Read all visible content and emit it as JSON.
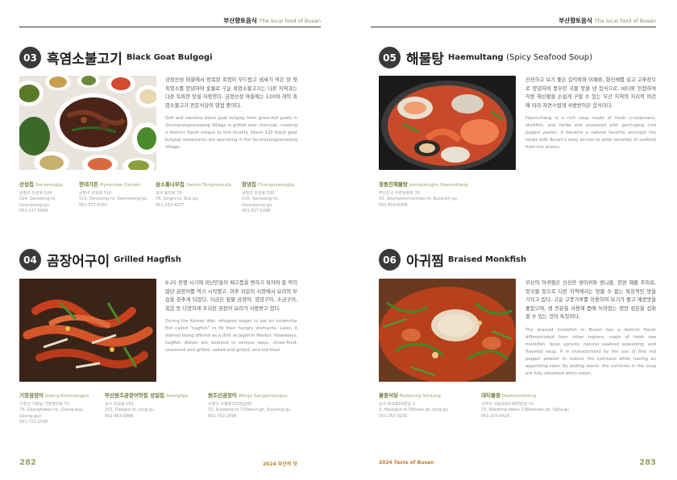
{
  "header": {
    "ko": "부산향토음식",
    "en": "The local food of Busan"
  },
  "left_page": {
    "page_number": "282",
    "footer": "2024 부산의 맛",
    "sections": [
      {
        "num": "03",
        "title_ko": "흑염소불고기",
        "title_en": "Black Goat Bulgogi",
        "title_en_light": "",
        "desc_ko": "금정산성 마을에서 방목된 흑염이 부드럽고 냄새가 적은 양 첫 흑염소를 양념하여 숯불로 구운 흑염소불고기는 다른 지역과는 다른 독특한 맛을 자랑한다. 금정산성 마을에는 120여 개의 흑염소불고기 전문식당이 영업 중이다.",
        "desc_en": "Soft and odorless black goat bulgogi from grass-fed goats in Geumjeongsanseong Village is grilled over charcoal, creating a distinct flavor unique to this locality. About 120 black goat bulgogi restaurants are operating in the Geumjeongsanseong Village.",
        "restaurants": [
          {
            "name_ko": "산성집",
            "name_en": "Sanseongjip",
            "lines": [
              "금정구 산성로 524",
              "524, Sanseong-ro,",
              "Geumjeong-gu",
              "051-517-5566"
            ]
          },
          {
            "name_ko": "현대가든",
            "name_en": "Hyeondae Garden",
            "lines": [
              "금정구 산성로 510",
              "510, Sanseong-ro, Geumjeong-gu",
              "051-517-6767"
            ]
          },
          {
            "name_ko": "삼소통나무집",
            "name_en": "Samso Tongnamujip",
            "lines": [
              "북구 효리로 78",
              "78, Jungni-ro, Buk-gu",
              "051-333-4277"
            ]
          },
          {
            "name_ko": "창녕집",
            "name_en": "Changnyeongjip",
            "lines": [
              "금정구 산성로 520",
              "520, Sanseong-ro,",
              "Geumjeong-gu",
              "051-517-5288"
            ]
          }
        ]
      },
      {
        "num": "04",
        "title_ko": "곰장어구이",
        "title_en": "Grilled Hagfish",
        "title_en_light": "",
        "desc_ko": "6·25 전쟁 시기에 피난민들이 배고픔을 면하기 위하여 잘 먹지 않던 곰장어를 먹기 시작했고, 이후 자갈치 시장에서 요리의 모습을 갖추게 되었다. 지금은 짚불 곰장어, 양념구이, 소금구이, 볶음 등 다양하게 조리된 곰장어 요리가 사랑받고 있다.",
        "desc_en": "During the Korean War, refugees began to eat an unfamiliar fish called \"hagfish\" to fill their hungry stomachs. Later, it started being offered as a dish at Jagalchi Market. Nowadays, hagfish dishes are beloved in various ways, straw-fired, seasoned and grilled, salted and grilled, and stir-fried.",
        "restaurants": [
          {
            "name_ko": "기장곰장어",
            "name_en": "Gijang Kkomjangeo",
            "lines": [
              "기장군 기장읍 기장해안로 70",
              "70, Gijanghaean-ro, Gijang-eup,",
              "Gijang-gun",
              "051-721-2936"
            ]
          },
          {
            "name_ko": "부산원조곰장어맛집 성일집",
            "name_en": "Seongiljip",
            "lines": [
              "중구 대교로 103",
              "103, Daegyo-ro, Jung-gu",
              "051-463-5888"
            ]
          },
          {
            "name_ko": "원조산곰장어",
            "name_en": "Wonjo Sangomjangeo",
            "lines": [
              "수영구 수영로725번길32",
              "32, Suyeong-ro 725beon-gil, Suyeong-gu",
              "051-752-2596"
            ]
          }
        ]
      }
    ]
  },
  "right_page": {
    "page_number": "283",
    "footer": "2024 Taste of Busan",
    "sections": [
      {
        "num": "05",
        "title_ko": "해물탕",
        "title_en": "Haemultang",
        "title_en_light": "(Spicy Seafood Soup)",
        "desc_ko": "신선하고 보기 좋은 갑각류와 어패류, 향신채를 넣고 고추장으로 양념하여 풍부한 국물 맛을 낸 음식으로, 바다와 인접하여 각종 해산물을 손쉽게 구할 수 있는 부산 지역의 지리적 여건에 따라 자연스럽게 사랑받아온 음식이다.",
        "desc_en": "Haemultang is a rich soup made of fresh crustaceans, shellfish, and herbs and seasoned with gochujang (red pepper paste). It became a natural favorite amongst the locals with Busan's easy access to wide varieties of seafood from the shores.",
        "restaurants": [
          {
            "name_ko": "정동진해물탕",
            "name_en": "Jeongdongjin Haemultang",
            "lines": [
              "부산진구 서면문화로 33",
              "33, Seomyeonmunhwa-ro, Busanjin-gu",
              "051-809-8208"
            ]
          }
        ]
      },
      {
        "num": "06",
        "title_ko": "아귀찜",
        "title_en": "Braised Monkfish",
        "title_en_light": "",
        "desc_ko": "부산의 아귀찜은 신선한 생아귀와 콩나물, 천연 해물 조미료, 맛국물 등으로 다른 지역에서는 맛볼 수 없는 특징적인 맛을 가지고 있다. 고운 고춧가루를 이용하여 보기가 좋고 매콤맛을 좋았으며, 생 전분을 사용해 즙에 녹아있는 영양 성분을 섭취할 수 있는 것이 특징이다.",
        "desc_en": "The braised monkfish in Busan has a distinct flavor differentiated from other regions, made of fresh raw monkfish, bean sprouts, natural seafood seasoning, and flavored soup. It is characterized by the use of fine red pepper powder to reduce the spiciness while having an appetizing color. By adding starch, the nutrients in the soup are fully absorbed when eaten.",
        "restaurants": [
          {
            "name_ko": "물꽁식당",
            "name_en": "Mulkkong Sikdang",
            "lines": [
              "중구 흑교로59번길 3",
              "3, Heukgyo-ro 59beon-gil, Jung-gu",
              "051-257-3230"
            ]
          },
          {
            "name_ko": "대티물꽁",
            "name_en": "Daetimulkkong",
            "lines": [
              "사하구 낙동대로138번안길 15",
              "15, Nakdong-daero 138beonan-gil, Saha-gu",
              "051-203-4425"
            ]
          }
        ]
      }
    ]
  }
}
